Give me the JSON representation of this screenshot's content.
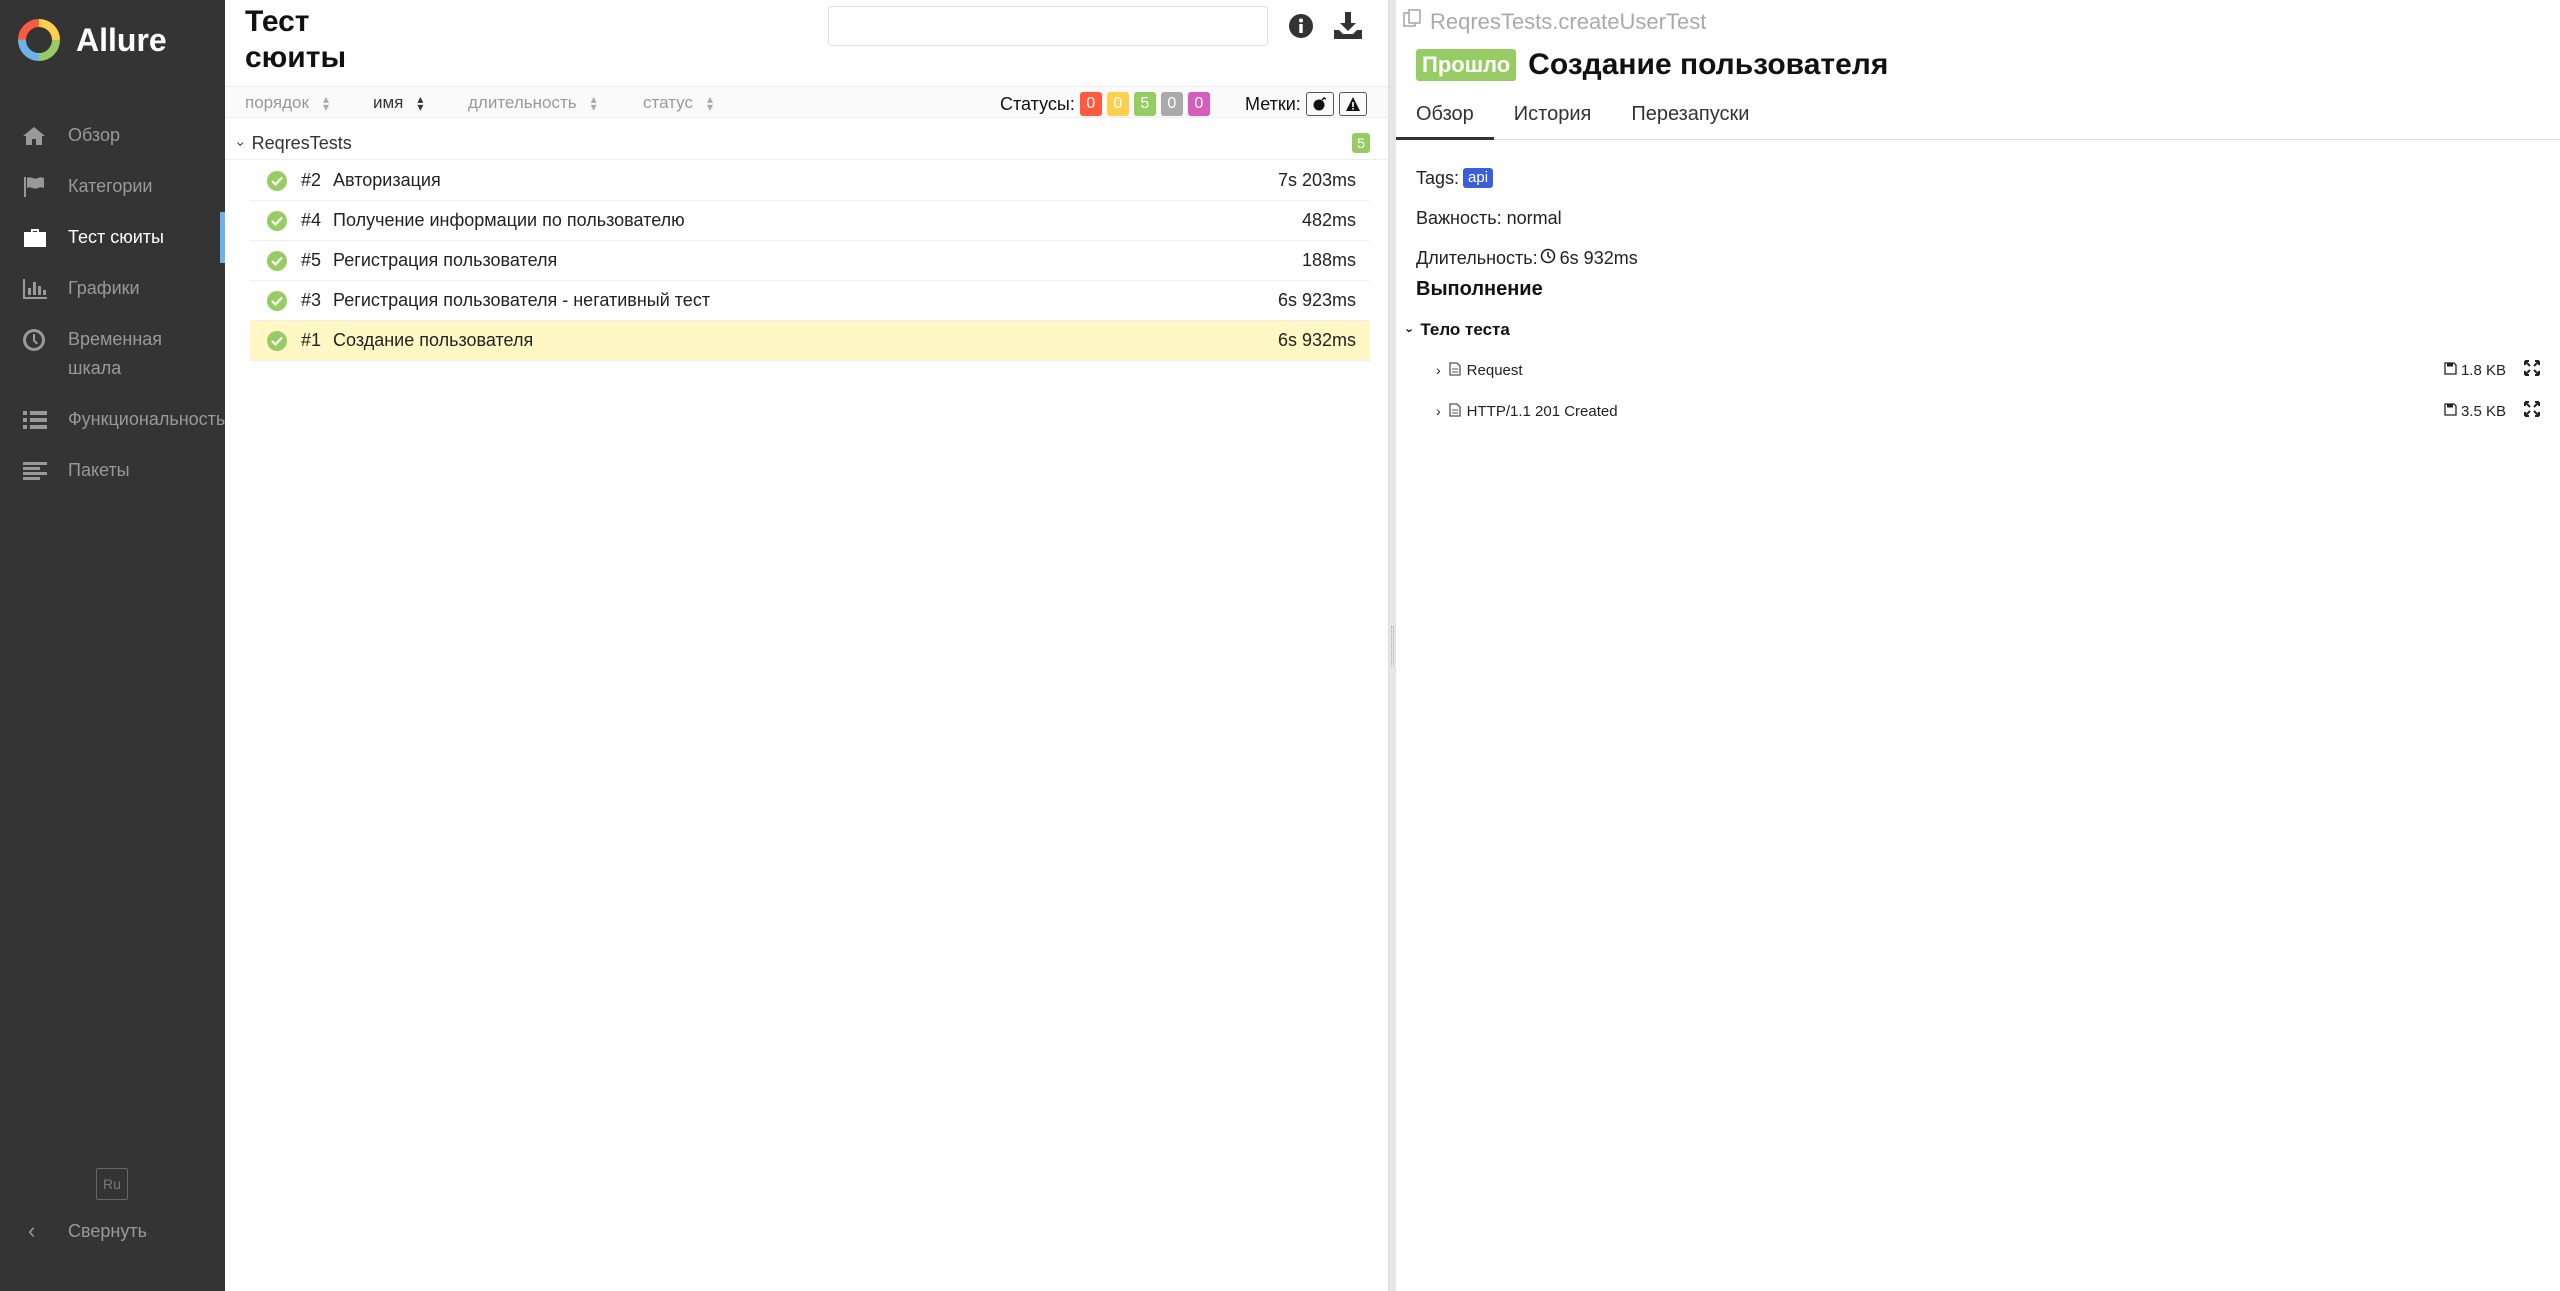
{
  "brand": {
    "name": "Allure"
  },
  "sidebar": {
    "items": [
      {
        "label": "Обзор",
        "icon": "home-icon"
      },
      {
        "label": "Категории",
        "icon": "flag-icon"
      },
      {
        "label": "Тест сюиты",
        "icon": "briefcase-icon",
        "active": true
      },
      {
        "label": "Графики",
        "icon": "bar-chart-icon"
      },
      {
        "label": "Временная шкала",
        "icon": "clock-icon"
      },
      {
        "label": "Функциональность",
        "icon": "list-icon"
      },
      {
        "label": "Пакеты",
        "icon": "align-left-icon"
      }
    ],
    "lang": "Ru",
    "collapse_label": "Свернуть"
  },
  "middle": {
    "title": "Тест сюиты",
    "search_value": "",
    "sort": {
      "order": "порядок",
      "name": "имя",
      "duration": "длительность",
      "status": "статус"
    },
    "statuses_label": "Статусы:",
    "status_counts": [
      {
        "value": "0",
        "color": "#fd5a3e"
      },
      {
        "value": "0",
        "color": "#ffd050"
      },
      {
        "value": "5",
        "color": "#97cc64"
      },
      {
        "value": "0",
        "color": "#aaaaaa"
      },
      {
        "value": "0",
        "color": "#d35ebe"
      }
    ],
    "marks_label": "Метки:",
    "group": {
      "name": "ReqresTests",
      "count": "5"
    },
    "rows": [
      {
        "num": "#2",
        "name": "Авторизация",
        "duration": "7s 203ms"
      },
      {
        "num": "#4",
        "name": "Получение информации по пользователю",
        "duration": "482ms"
      },
      {
        "num": "#5",
        "name": "Регистрация пользователя",
        "duration": "188ms"
      },
      {
        "num": "#3",
        "name": "Регистрация пользователя - негативный тест",
        "duration": "6s 923ms"
      },
      {
        "num": "#1",
        "name": "Создание пользователя",
        "duration": "6s 932ms",
        "selected": true
      }
    ]
  },
  "detail": {
    "fullname": "ReqresTests.createUserTest",
    "status": "Прошло",
    "title": "Создание пользователя",
    "tabs": [
      "Обзор",
      "История",
      "Перезапуски"
    ],
    "tags_label": "Tags:",
    "tag": "api",
    "severity_label": "Важность:",
    "severity": "normal",
    "duration_label": "Длительность:",
    "duration": "6s 932ms",
    "execution_heading": "Выполнение",
    "body_heading": "Тело теста",
    "attachments": [
      {
        "name": "Request",
        "size": "1.8 KB"
      },
      {
        "name": "HTTP/1.1 201 Created",
        "size": "3.5 KB"
      }
    ]
  },
  "colors": {
    "sidebar_bg": "#343434",
    "passed": "#97cc64",
    "tag": "#3b5fd9",
    "selected_row": "#fff8c4"
  }
}
